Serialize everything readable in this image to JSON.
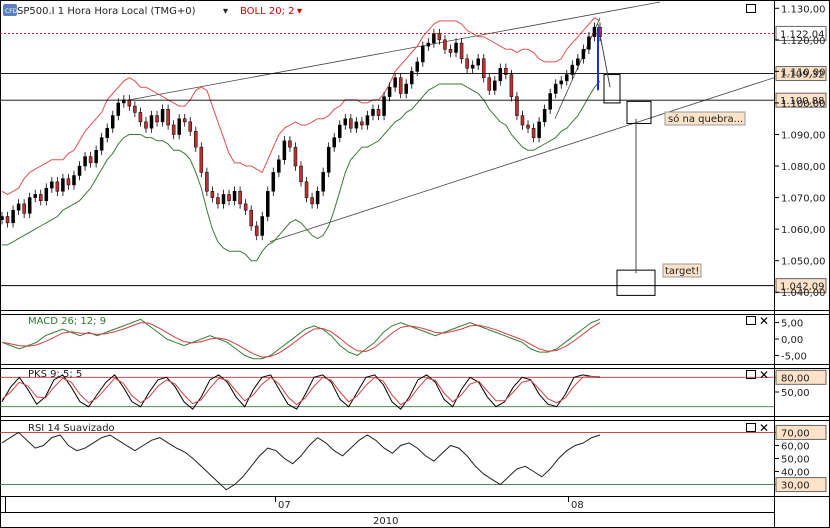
{
  "chart_data": [
    {
      "type": "candlestick",
      "panel": "price",
      "symbol_label": "SP500.I 1 Hora Hora Local (TMG+0)",
      "symbol_icon": "CFD",
      "indicator_label": "BOLL 20; 2",
      "ylim": [
        1.035,
        1.132
      ],
      "y_ticks": [
        "1.130,00",
        "1.120,00",
        "1.110,00",
        "1.100,00",
        "1.090,00",
        "1.080,00",
        "1.070,00",
        "1.060,00",
        "1.050,00",
        "1.040,00"
      ],
      "y_tick_values": [
        1.13,
        1.12,
        1.11,
        1.1,
        1.09,
        1.08,
        1.07,
        1.06,
        1.05,
        1.04
      ],
      "close": [
        1.064,
        1.062,
        1.066,
        1.068,
        1.065,
        1.07,
        1.071,
        1.069,
        1.073,
        1.075,
        1.072,
        1.076,
        1.074,
        1.077,
        1.08,
        1.083,
        1.081,
        1.085,
        1.089,
        1.092,
        1.096,
        1.1,
        1.101,
        1.099,
        1.097,
        1.094,
        1.092,
        1.096,
        1.094,
        1.098,
        1.093,
        1.09,
        1.095,
        1.094,
        1.091,
        1.086,
        1.078,
        1.072,
        1.07,
        1.068,
        1.071,
        1.069,
        1.072,
        1.068,
        1.066,
        1.061,
        1.058,
        1.064,
        1.072,
        1.078,
        1.082,
        1.088,
        1.086,
        1.08,
        1.075,
        1.07,
        1.068,
        1.072,
        1.078,
        1.086,
        1.089,
        1.093,
        1.095,
        1.092,
        1.094,
        1.093,
        1.096,
        1.098,
        1.096,
        1.102,
        1.105,
        1.108,
        1.103,
        1.106,
        1.11,
        1.113,
        1.118,
        1.119,
        1.122,
        1.12,
        1.117,
        1.116,
        1.119,
        1.114,
        1.111,
        1.112,
        1.114,
        1.108,
        1.104,
        1.107,
        1.111,
        1.109,
        1.102,
        1.096,
        1.093,
        1.092,
        1.089,
        1.094,
        1.098,
        1.103,
        1.106,
        1.107,
        1.109,
        1.112,
        1.114,
        1.117,
        1.121,
        1.124,
        1.121
      ],
      "upper_band": [
        1.072,
        1.071,
        1.072,
        1.073,
        1.076,
        1.078,
        1.079,
        1.08,
        1.081,
        1.082,
        1.082,
        1.082,
        1.084,
        1.085,
        1.088,
        1.091,
        1.093,
        1.095,
        1.097,
        1.101,
        1.103,
        1.105,
        1.107,
        1.108,
        1.107,
        1.105,
        1.105,
        1.104,
        1.103,
        1.102,
        1.101,
        1.1,
        1.099,
        1.099,
        1.101,
        1.104,
        1.105,
        1.104,
        1.099,
        1.094,
        1.089,
        1.084,
        1.081,
        1.081,
        1.08,
        1.08,
        1.079,
        1.078,
        1.082,
        1.086,
        1.09,
        1.092,
        1.093,
        1.094,
        1.093,
        1.093,
        1.094,
        1.095,
        1.095,
        1.096,
        1.098,
        1.099,
        1.101,
        1.101,
        1.101,
        1.1,
        1.1,
        1.101,
        1.101,
        1.103,
        1.106,
        1.11,
        1.112,
        1.114,
        1.116,
        1.118,
        1.121,
        1.123,
        1.125,
        1.126,
        1.126,
        1.126,
        1.126,
        1.125,
        1.123,
        1.122,
        1.121,
        1.121,
        1.12,
        1.119,
        1.118,
        1.117,
        1.117,
        1.116,
        1.117,
        1.117,
        1.116,
        1.114,
        1.113,
        1.113,
        1.113,
        1.114,
        1.117,
        1.119,
        1.121,
        1.123,
        1.125,
        1.127,
        1.126
      ],
      "lower_band": [
        1.055,
        1.055,
        1.056,
        1.057,
        1.058,
        1.059,
        1.06,
        1.061,
        1.062,
        1.063,
        1.064,
        1.066,
        1.067,
        1.068,
        1.069,
        1.071,
        1.073,
        1.076,
        1.079,
        1.082,
        1.084,
        1.087,
        1.089,
        1.09,
        1.09,
        1.09,
        1.089,
        1.089,
        1.088,
        1.088,
        1.087,
        1.085,
        1.085,
        1.084,
        1.082,
        1.078,
        1.073,
        1.066,
        1.06,
        1.056,
        1.054,
        1.053,
        1.053,
        1.053,
        1.052,
        1.05,
        1.05,
        1.053,
        1.055,
        1.056,
        1.058,
        1.06,
        1.062,
        1.063,
        1.062,
        1.06,
        1.058,
        1.057,
        1.058,
        1.061,
        1.066,
        1.072,
        1.078,
        1.082,
        1.084,
        1.086,
        1.086,
        1.087,
        1.088,
        1.09,
        1.092,
        1.094,
        1.095,
        1.097,
        1.098,
        1.1,
        1.102,
        1.104,
        1.105,
        1.106,
        1.106,
        1.106,
        1.106,
        1.106,
        1.105,
        1.104,
        1.103,
        1.101,
        1.098,
        1.096,
        1.094,
        1.093,
        1.09,
        1.088,
        1.086,
        1.085,
        1.085,
        1.086,
        1.087,
        1.088,
        1.089,
        1.091,
        1.092,
        1.094,
        1.096,
        1.099,
        1.102,
        1.105,
        1.107
      ],
      "horizontal_levels": [
        {
          "value": 1.12204,
          "label": "1.122,04",
          "style": "dotted-red"
        },
        {
          "value": 1.10932,
          "label": "1.109,32",
          "style": "solid"
        },
        {
          "value": 1.10088,
          "label": "1.100,88",
          "style": "solid"
        },
        {
          "value": 1.04209,
          "label": "1.042,09",
          "style": "solid"
        }
      ],
      "annotations": [
        "só na quebra...",
        "target!"
      ]
    },
    {
      "type": "line",
      "panel": "macd",
      "indicator_label": "MACD 26; 12; 9",
      "ylim": [
        -7,
        7
      ],
      "y_ticks": [
        "5,00",
        "0,00",
        "-5,00"
      ],
      "y_tick_values": [
        5,
        0,
        -5
      ],
      "series": [
        {
          "values": [
            -1,
            -2,
            -3,
            -2,
            -1,
            1,
            2,
            3,
            2,
            1,
            2,
            1,
            2,
            3,
            4,
            5,
            6,
            4,
            2,
            0,
            -1,
            -2,
            -1,
            0,
            1,
            0,
            -1,
            -3,
            -5,
            -6,
            -6,
            -5,
            -3,
            -1,
            1,
            3,
            4,
            3,
            1,
            -2,
            -4,
            -5,
            -3,
            -1,
            2,
            4,
            5,
            4,
            3,
            2,
            1,
            2,
            3,
            4,
            5,
            4,
            3,
            2,
            1,
            0,
            -1,
            -3,
            -4,
            -4,
            -3,
            -1,
            1,
            3,
            5,
            6
          ]
        },
        {
          "values": [
            -1,
            -1.5,
            -2,
            -2.2,
            -1.8,
            -0.8,
            0.5,
            1.8,
            2.2,
            1.8,
            1.7,
            1.4,
            1.6,
            2.2,
            3,
            4,
            5,
            4.8,
            3.5,
            2,
            0.5,
            -0.8,
            -1.2,
            -0.8,
            0,
            0.3,
            -0.2,
            -1.5,
            -3,
            -4.5,
            -5.5,
            -5.3,
            -4.2,
            -2.5,
            -0.5,
            1.5,
            3,
            3.2,
            2.2,
            0.2,
            -2,
            -3.6,
            -3.8,
            -2.6,
            -0.5,
            1.8,
            3.5,
            4,
            3.6,
            2.9,
            2,
            1.8,
            2.3,
            3,
            4,
            4.2,
            3.6,
            2.8,
            1.8,
            0.8,
            -0.2,
            -1.6,
            -3,
            -3.7,
            -3.5,
            -2.3,
            -0.6,
            1.4,
            3.4,
            5
          ]
        }
      ]
    },
    {
      "type": "line",
      "panel": "stochastic",
      "indicator_label": "PKS 9; 5; 5",
      "ylim": [
        5,
        95
      ],
      "y_ticks": [
        "80,00",
        "50,00"
      ],
      "y_tick_values": [
        80,
        50
      ],
      "series": [
        {
          "values": [
            30,
            60,
            80,
            55,
            25,
            40,
            75,
            85,
            60,
            30,
            20,
            45,
            70,
            85,
            60,
            30,
            20,
            50,
            75,
            80,
            60,
            30,
            15,
            40,
            75,
            85,
            70,
            40,
            20,
            55,
            80,
            85,
            55,
            25,
            15,
            45,
            80,
            85,
            70,
            35,
            20,
            50,
            80,
            85,
            65,
            30,
            15,
            40,
            75,
            85,
            70,
            35,
            20,
            55,
            80,
            70,
            40,
            20,
            30,
            60,
            80,
            75,
            45,
            25,
            20,
            45,
            80,
            85,
            82,
            80
          ]
        },
        {
          "values": [
            35,
            50,
            70,
            62,
            40,
            38,
            60,
            78,
            70,
            45,
            28,
            38,
            58,
            78,
            68,
            42,
            28,
            40,
            62,
            75,
            66,
            44,
            26,
            34,
            58,
            78,
            74,
            52,
            32,
            44,
            66,
            80,
            66,
            40,
            24,
            38,
            62,
            80,
            74,
            50,
            30,
            42,
            64,
            80,
            72,
            44,
            24,
            34,
            58,
            78,
            74,
            48,
            30,
            44,
            66,
            72,
            52,
            32,
            32,
            50,
            70,
            74,
            56,
            36,
            28,
            38,
            62,
            80,
            82,
            81
          ]
        }
      ]
    },
    {
      "type": "line",
      "panel": "rsi",
      "indicator_label": "RSI 14 Suavizado",
      "ylim": [
        22,
        78
      ],
      "y_ticks": [
        "70,00",
        "60,00",
        "50,00",
        "40,00",
        "30,00"
      ],
      "y_tick_values": [
        70,
        60,
        50,
        40,
        30
      ],
      "values": [
        62,
        66,
        70,
        64,
        58,
        60,
        66,
        68,
        60,
        56,
        58,
        62,
        66,
        68,
        64,
        60,
        56,
        60,
        64,
        66,
        62,
        58,
        55,
        50,
        44,
        38,
        32,
        26,
        30,
        36,
        44,
        52,
        58,
        56,
        50,
        46,
        52,
        60,
        66,
        62,
        56,
        52,
        58,
        64,
        68,
        64,
        58,
        54,
        60,
        62,
        58,
        52,
        48,
        54,
        60,
        58,
        52,
        44,
        38,
        34,
        30,
        36,
        42,
        44,
        40,
        36,
        42,
        50,
        56,
        60,
        62,
        66,
        68
      ],
      "x_ticks": [
        "07",
        "08"
      ],
      "x_axis_year": "2010"
    }
  ],
  "ui": {
    "close_glyph": "✕",
    "window_glyph": "□",
    "dropdown_glyph": "▾"
  }
}
